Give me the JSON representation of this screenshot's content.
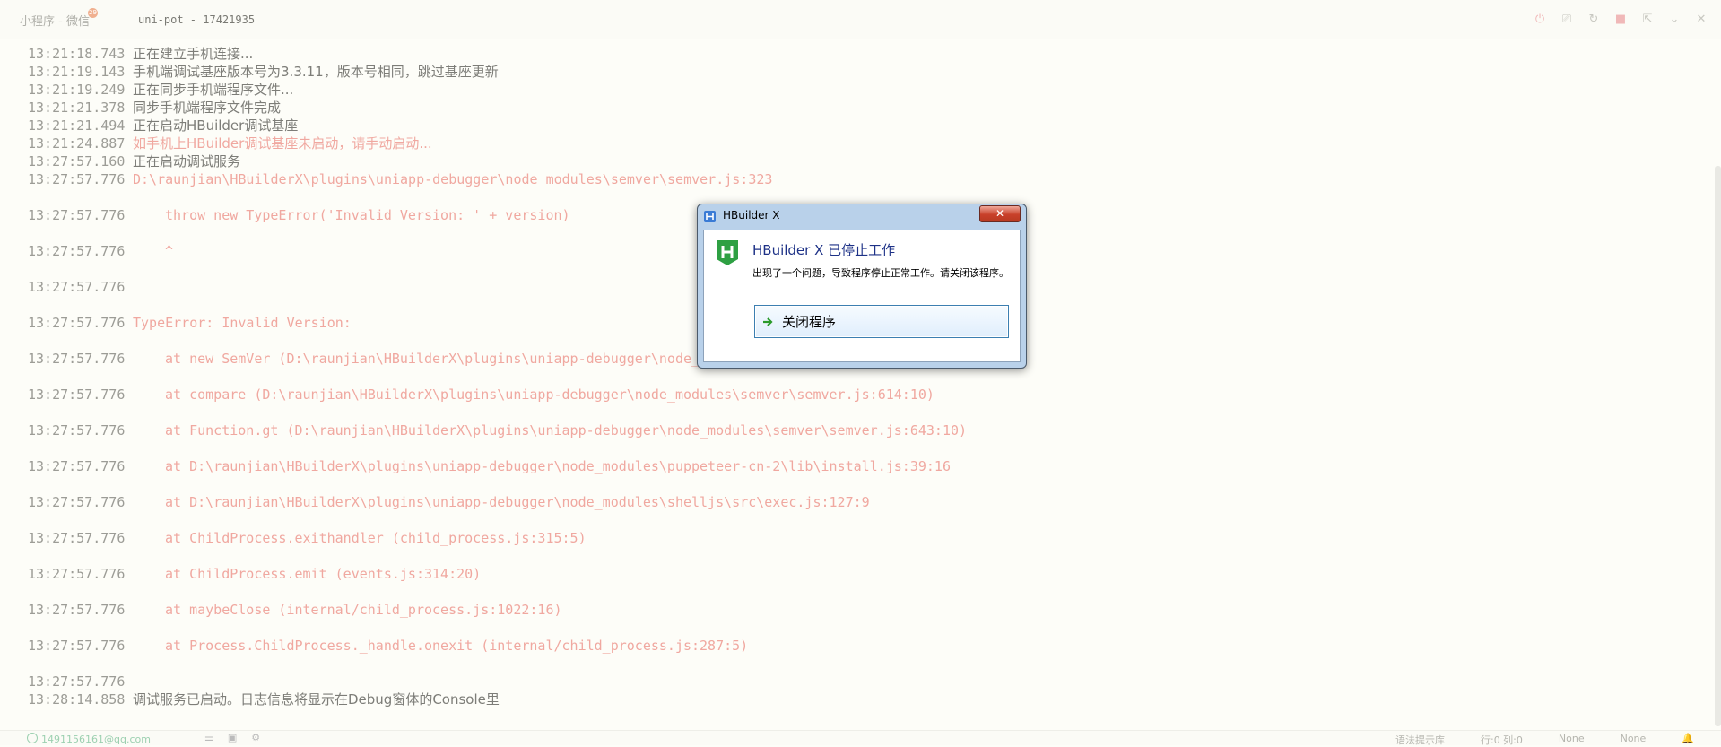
{
  "tabs": {
    "wechat": {
      "label": "小程序 - 微信",
      "badge": "29"
    },
    "console": {
      "label": "uni-pot - 17421935"
    }
  },
  "toolbar": {
    "icons": [
      "stop-icon",
      "clear-icon",
      "restart-icon",
      "stop-square-icon",
      "export-icon",
      "collapse-icon",
      "close-all-icon"
    ]
  },
  "console": {
    "lines": [
      {
        "ts": "13:21:18.743",
        "text": "正在建立手机连接...",
        "style": "cn"
      },
      {
        "ts": "13:21:19.143",
        "text": "手机端调试基座版本号为3.3.11，版本号相同，跳过基座更新",
        "style": "cn"
      },
      {
        "ts": "13:21:19.249",
        "text": "正在同步手机端程序文件...",
        "style": "cn"
      },
      {
        "ts": "13:21:21.378",
        "text": "同步手机端程序文件完成",
        "style": "cn"
      },
      {
        "ts": "13:21:21.494",
        "text": "正在启动HBuilder调试基座",
        "style": "cn"
      },
      {
        "ts": "13:21:24.887",
        "text": "如手机上HBuilder调试基座未启动，请手动启动...",
        "style": "cn-err"
      },
      {
        "ts": "13:27:57.160",
        "text": "正在启动调试服务",
        "style": "cn"
      },
      {
        "ts": "13:27:57.776",
        "text": "D:\\raunjian\\HBuilderX\\plugins\\uniapp-debugger\\node_modules\\semver\\semver.js:323",
        "style": "err"
      },
      {
        "ts": "13:27:57.776",
        "text": "throw new TypeError('Invalid Version: ' + version)",
        "style": "err-indent",
        "gap": true
      },
      {
        "ts": "13:27:57.776",
        "text": "^",
        "style": "err-indent",
        "gap": true
      },
      {
        "ts": "13:27:57.776",
        "text": "",
        "style": "err",
        "gap": true
      },
      {
        "ts": "13:27:57.776",
        "text": "TypeError: Invalid Version:",
        "style": "err",
        "gap": true
      },
      {
        "ts": "13:27:57.776",
        "text": "at new SemVer (D:\\raunjian\\HBuilderX\\plugins\\uniapp-debugger\\node_",
        "style": "err-indent",
        "gap": true
      },
      {
        "ts": "13:27:57.776",
        "text": "at compare (D:\\raunjian\\HBuilderX\\plugins\\uniapp-debugger\\node_modules\\semver\\semver.js:614:10)",
        "style": "err-indent",
        "gap": true
      },
      {
        "ts": "13:27:57.776",
        "text": "at Function.gt (D:\\raunjian\\HBuilderX\\plugins\\uniapp-debugger\\node_modules\\semver\\semver.js:643:10)",
        "style": "err-indent",
        "gap": true
      },
      {
        "ts": "13:27:57.776",
        "text": "at D:\\raunjian\\HBuilderX\\plugins\\uniapp-debugger\\node_modules\\puppeteer-cn-2\\lib\\install.js:39:16",
        "style": "err-indent",
        "gap": true
      },
      {
        "ts": "13:27:57.776",
        "text": "at D:\\raunjian\\HBuilderX\\plugins\\uniapp-debugger\\node_modules\\shelljs\\src\\exec.js:127:9",
        "style": "err-indent",
        "gap": true
      },
      {
        "ts": "13:27:57.776",
        "text": "at ChildProcess.exithandler (child_process.js:315:5)",
        "style": "err-indent",
        "gap": true
      },
      {
        "ts": "13:27:57.776",
        "text": "at ChildProcess.emit (events.js:314:20)",
        "style": "err-indent",
        "gap": true
      },
      {
        "ts": "13:27:57.776",
        "text": "at maybeClose (internal/child_process.js:1022:16)",
        "style": "err-indent",
        "gap": true
      },
      {
        "ts": "13:27:57.776",
        "text": "at Process.ChildProcess._handle.onexit (internal/child_process.js:287:5)",
        "style": "err-indent",
        "gap": true
      },
      {
        "ts": "13:27:57.776",
        "text": "",
        "style": "err",
        "gap": true
      },
      {
        "ts": "13:28:14.858",
        "text": "调试服务已启动。日志信息将显示在Debug窗体的Console里",
        "style": "cn"
      }
    ]
  },
  "dialog": {
    "title": "HBuilder X",
    "close_glyph": "✕",
    "heading": "HBuilder X 已停止工作",
    "message": "出现了一个问题，导致程序停止正常工作。请关闭该程序。",
    "button_label": "关闭程序"
  },
  "statusbar": {
    "account": "1491156161@qq.com",
    "hint": "语法提示库",
    "position": "行:0  列:0",
    "encoding": "None",
    "syntax": "None"
  },
  "colors": {
    "error_text": "#f0a8a0",
    "dialog_heading": "#1e3287",
    "hbuilder_green": "#2ea043"
  }
}
